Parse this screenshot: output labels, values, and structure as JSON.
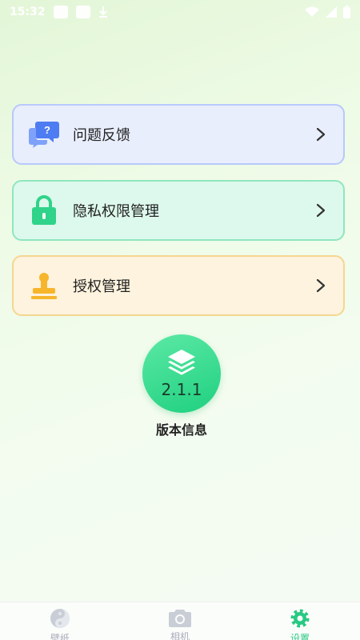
{
  "status_bar": {
    "time": "15:32"
  },
  "menu": [
    {
      "id": "feedback",
      "label": "问题反馈",
      "icon": "chat-question-icon"
    },
    {
      "id": "privacy",
      "label": "隐私权限管理",
      "icon": "lock-icon"
    },
    {
      "id": "auth",
      "label": "授权管理",
      "icon": "stamp-icon"
    }
  ],
  "version": {
    "number": "2.1.1",
    "label": "版本信息",
    "icon": "layers-icon"
  },
  "nav": [
    {
      "label": "壁纸",
      "icon": "yin-yang-icon"
    },
    {
      "label": "相机",
      "icon": "camera-icon"
    },
    {
      "label": "设置",
      "icon": "gear-icon"
    }
  ],
  "colors": {
    "accent": "#29c982",
    "feedback": "#4e7cf2",
    "privacy": "#2fd38a",
    "auth": "#f7b52c"
  }
}
